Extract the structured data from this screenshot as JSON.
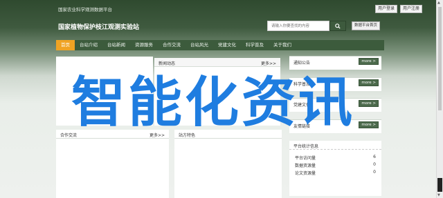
{
  "topbar": {
    "title": "国家农业科学观测数据平台",
    "links": [
      "用户登录",
      "用户注册"
    ]
  },
  "header": {
    "site_title": "国家植物保护枝江观测实验站",
    "search_placeholder": "请输入你要查找的内容",
    "data_button": "数据平台首页"
  },
  "nav": {
    "items": [
      "首页",
      "台站介绍",
      "台站新闻",
      "资源服务",
      "合作交流",
      "台站风光",
      "党建文化",
      "科学普及",
      "关于我们"
    ]
  },
  "panels": {
    "news": {
      "title": "新闻动态",
      "more": "更多>>"
    },
    "cooperation": {
      "title": "合作交流",
      "more": "更多>>"
    },
    "scenery": {
      "title": "站方特色"
    }
  },
  "sidebar": {
    "notice": {
      "title": "通知公告",
      "more": "more >"
    },
    "science": {
      "title": "科学普及",
      "more": "more >"
    },
    "party": {
      "title": "党建文化",
      "more": "more >"
    },
    "links": {
      "title": "友情链接",
      "more": "more >"
    },
    "stats": {
      "title": "平台统计信息",
      "rows": [
        {
          "label": "平台访问量",
          "value": "6"
        },
        {
          "label": "数据资源量",
          "value": "0"
        },
        {
          "label": "论文资源量",
          "value": "0"
        }
      ]
    }
  },
  "overlay": {
    "text": "智能化资讯"
  },
  "colors": {
    "nav_active": "#f0a323",
    "nav_bg": "#3c5b3c",
    "overlay": "#1f7de0"
  }
}
